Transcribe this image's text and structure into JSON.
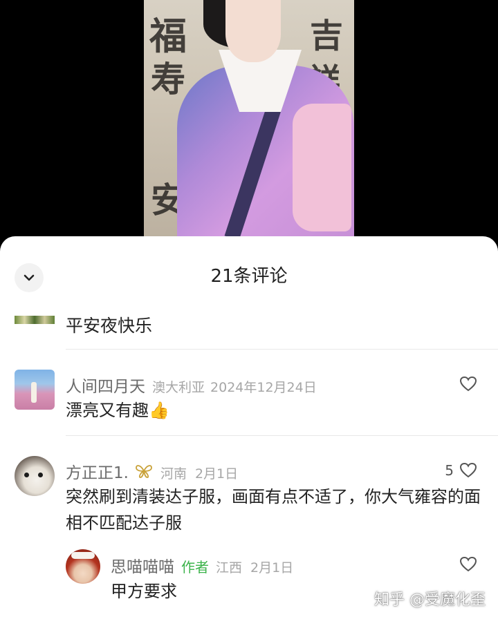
{
  "sheet": {
    "title": "21条评论",
    "top_comment_text": "平安夜快乐"
  },
  "comments": [
    {
      "username": "人间四月天",
      "location": "澳大利亚",
      "date": "2024年12月24日",
      "text": "漂亮又有趣",
      "emoji": "👍",
      "likes": ""
    },
    {
      "username": "方正正1.",
      "badge_icon": "butterfly-icon",
      "location": "河南",
      "date": "2月1日",
      "text": "突然刷到清装达子服，画面有点不适了，你大气雍容的面相不匹配达子服",
      "likes": "5"
    }
  ],
  "reply": {
    "username": "思喵喵喵",
    "author_label": "作者",
    "location": "江西",
    "date": "2月1日",
    "text": "甲方要求"
  },
  "watermark": "知乎 @受魔化歪",
  "colors": {
    "author_badge": "#3bb34a",
    "meta_gray": "#a6a6a6",
    "username_gray": "#6b6b6b",
    "sheet_bg": "#ffffff",
    "backdrop": "#000000"
  }
}
